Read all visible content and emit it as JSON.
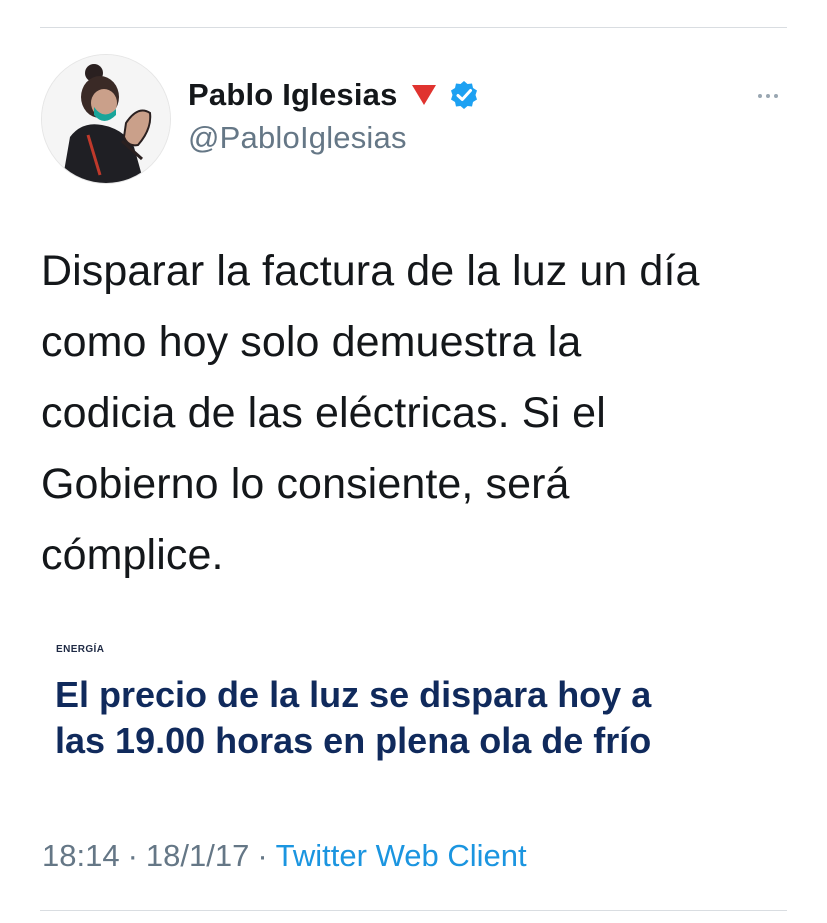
{
  "user": {
    "display_name": "Pablo Iglesias",
    "handle": "@PabloIglesias",
    "icons": [
      "profile-avatar-icon",
      "red-triangle-icon",
      "verified-badge-icon"
    ]
  },
  "tweet": {
    "text_lines": [
      "Disparar la factura de la luz un día",
      "como hoy solo demuestra la",
      "codicia de las eléctricas. Si el",
      "Gobierno lo consiente, será",
      "cómplice."
    ]
  },
  "article": {
    "section": "ENERGÍA",
    "headline_lines": [
      "El precio de la luz se dispara hoy a",
      "las 19.00 horas en plena ola de frío"
    ]
  },
  "meta": {
    "time": "18:14",
    "separator": "·",
    "date": "18/1/17",
    "source": "Twitter Web Client"
  },
  "colors": {
    "text_primary": "#14171a",
    "text_secondary": "#657786",
    "link": "#1b95e0",
    "verified": "#1da1f2",
    "headline": "#102a5c",
    "triangle": "#e0332f"
  }
}
